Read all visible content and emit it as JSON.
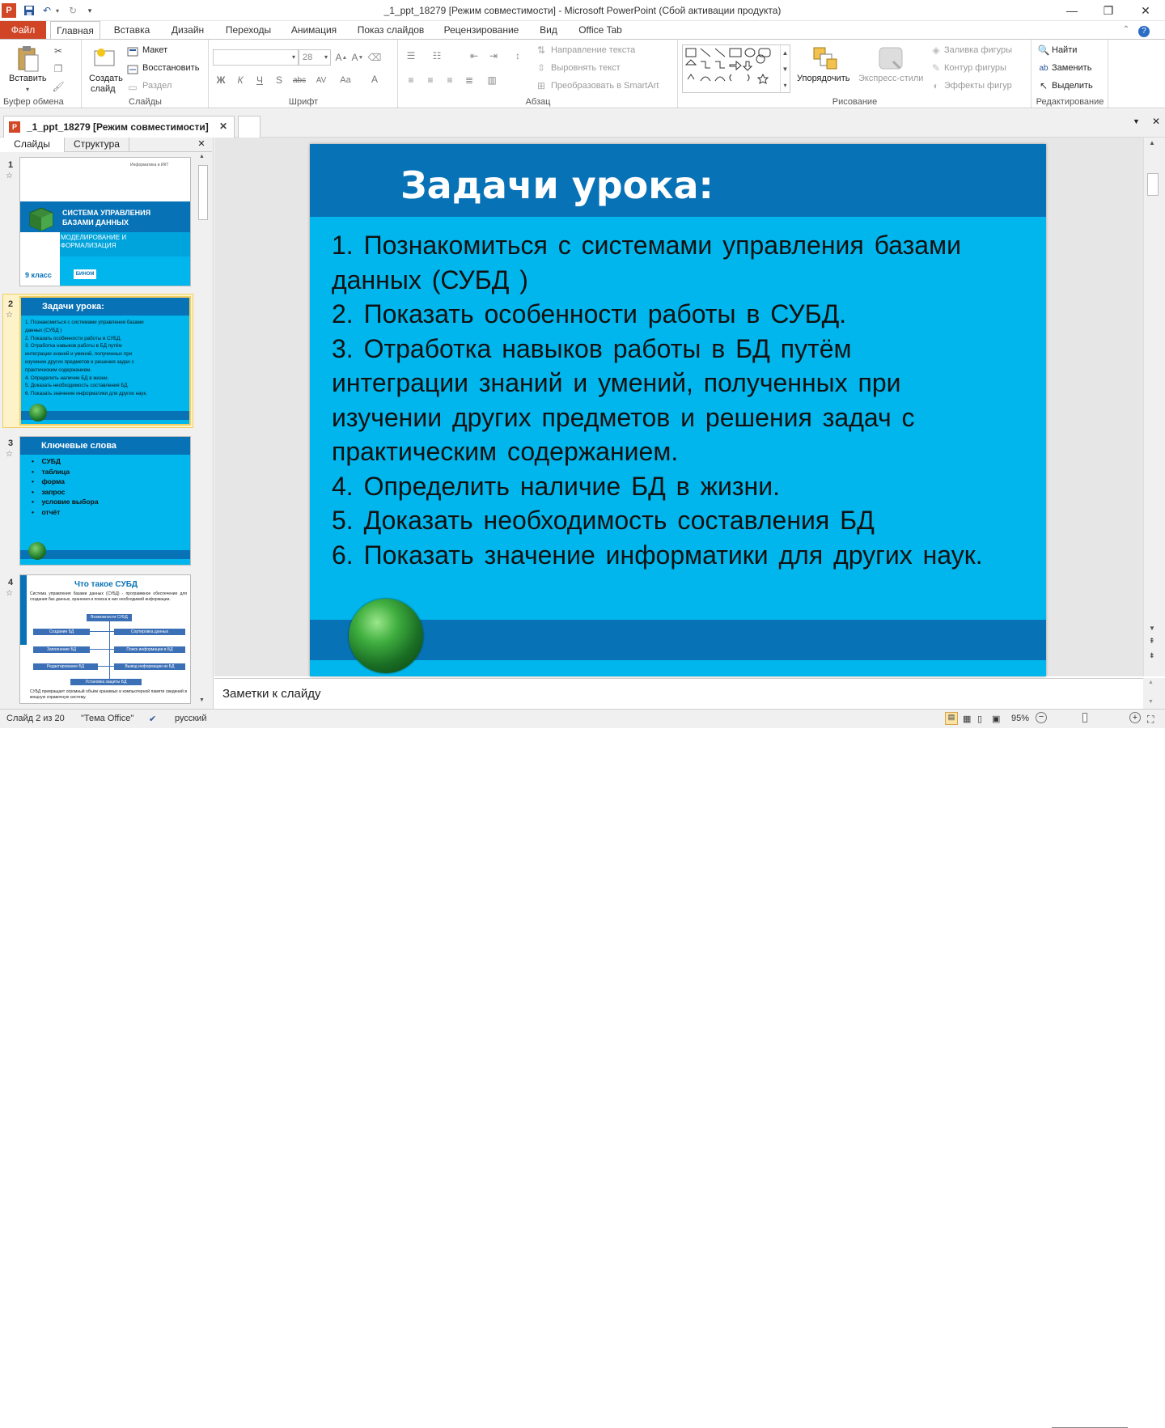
{
  "window": {
    "title": "_1_ppt_18279 [Режим совместимости]  -  Microsoft PowerPoint (Сбой активации продукта)"
  },
  "ribbon_tabs": [
    "Файл",
    "Главная",
    "Вставка",
    "Дизайн",
    "Переходы",
    "Анимация",
    "Показ слайдов",
    "Рецензирование",
    "Вид",
    "Office Tab"
  ],
  "ribbon": {
    "clipboard": {
      "paste": "Вставить",
      "label": "Буфер обмена"
    },
    "slides": {
      "new_slide": "Создать",
      "new_slide2": "слайд",
      "layout": "Макет",
      "reset": "Восстановить",
      "section": "Раздел",
      "label": "Слайды"
    },
    "font": {
      "size": "28",
      "label": "Шрифт"
    },
    "paragraph": {
      "text_direction": "Направление текста",
      "align_text": "Выровнять текст",
      "smartart": "Преобразовать в SmartArt",
      "label": "Абзац"
    },
    "drawing": {
      "arrange": "Упорядочить",
      "quick_styles": "Экспресс-стили",
      "fill": "Заливка фигуры",
      "outline": "Контур фигуры",
      "effects": "Эффекты фигур",
      "label": "Рисование"
    },
    "editing": {
      "find": "Найти",
      "replace": "Заменить",
      "select": "Выделить",
      "label": "Редактирование"
    }
  },
  "doc_tab": {
    "label": "_1_ppt_18279 [Режим совместимости]"
  },
  "pane_tabs": {
    "slides": "Слайды",
    "outline": "Структура"
  },
  "thumbnails": {
    "t1": {
      "num": "1",
      "top_text": "Информатика и ИКТ",
      "title1": "СИСТЕМА   УПРАВЛЕНИЯ",
      "title2": "БАЗАМИ   ДАННЫХ",
      "sub1": "МОДЕЛИРОВАНИЕ   И",
      "sub2": "ФОРМАЛИЗАЦИЯ",
      "grade": "9 класс",
      "logo": "БИНОМ"
    },
    "t2": {
      "num": "2",
      "title": "Задачи урока:",
      "lines": [
        "1. Познакомиться   с системами  управления  базами",
        "данных   (СУБД )",
        "2. Показать особенности  работы  в СУБД.",
        "3. Отработка  навыков  работы в БД путём",
        "интеграции  знаний  и умений,  полученных   при",
        "изучении  других  предметов  и решения  задач с",
        "практическим  содержанием.",
        "4. Определить  наличие  БД в жизни.",
        "5. Доказать  необходимость  составления  БД",
        "6. Показать значение  информатики для других  наук."
      ]
    },
    "t3": {
      "num": "3",
      "title": "Ключевые слова",
      "items": [
        "СУБД",
        "таблица",
        "форма",
        "запрос",
        "условие выбора",
        "отчёт"
      ]
    },
    "t4": {
      "num": "4",
      "title": "Что такое СУБД",
      "para": "Система    управления    базами    данных    (СУБД)   -   программное обеспечение для создания баз данных, хранения и поиска  в них необходимой   информации.",
      "box_top": "Возможности  СУБД",
      "left_boxes": [
        "Создание БД",
        "Заполнение БД",
        "Редактирование  БД"
      ],
      "right_boxes": [
        "Сортировка данных",
        "Поиск информации  в БД",
        "Вывод информации  из БД"
      ],
      "box_bottom": "Установка защиты  БД",
      "footer": "СУБД   превращает   огромный   объём   хранимых   в  компьютерной  памяти  сведений  в мощную  справочную  систему."
    }
  },
  "slide": {
    "title": "Задачи урока:",
    "lines": [
      "1. Познакомиться  с системами управления базами",
      "данных (СУБД )",
      "2. Показать особенности работы в СУБД.",
      "3. Отработка навыков работы в БД путём",
      "интеграции знаний и умений, полученных при",
      "изучении других предметов и решения задач с",
      "практическим содержанием.",
      "4. Определить наличие БД в жизни.",
      "5. Доказать необходимость составления БД",
      "6. Показать значение информатики для других наук."
    ]
  },
  "notes": {
    "placeholder": "Заметки к слайду"
  },
  "status": {
    "slide": "Слайд 2 из 20",
    "theme": "\"Тема Office\"",
    "lang": "русский",
    "zoom": "95%"
  }
}
